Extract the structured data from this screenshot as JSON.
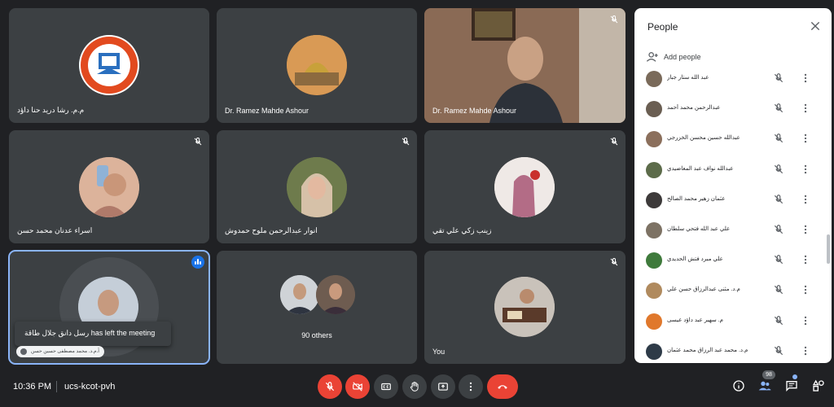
{
  "tiles": [
    {
      "name": "م.م. رشا دريد حنا داؤد",
      "muted": false
    },
    {
      "name": "Dr. Ramez Mahde Ashour",
      "muted": false
    },
    {
      "name": "Dr. Ramez Mahde Ashour",
      "muted": true
    },
    {
      "name": "اسراء عدنان محمد حسن",
      "muted": true
    },
    {
      "name": "انوار عبدالرحمن ملوح حمدوش",
      "muted": true
    },
    {
      "name": "زينب زكي علي تقي",
      "muted": true
    },
    {
      "name": "آ.م.د. محمد مصطفى حسين حسن",
      "muted": false
    },
    {
      "name": "90 others",
      "muted": false
    },
    {
      "name": "You",
      "muted": true
    }
  ],
  "toast": {
    "text": "رسل دانق جلال طاقة has left the meeting"
  },
  "hand_chip": {
    "text": "آ.م.د. محمد مصطفى حسين حسن"
  },
  "people": {
    "title": "People",
    "add_label": "Add people",
    "members": [
      {
        "name": "عبد الله ستار جبار"
      },
      {
        "name": "عبدالرحمن محمد أحمد"
      },
      {
        "name": "عبدالله حسين محسن الخزرجي"
      },
      {
        "name": "عبدالله نواف عبد المعاضيدي"
      },
      {
        "name": "عثمان زهير محمد الصالح"
      },
      {
        "name": "علي عبد الله فتحي سلطان"
      },
      {
        "name": "علي مبرد فتش الحديدي"
      },
      {
        "name": "م.د. مثنى عبدالرزاق حسن علي"
      },
      {
        "name": "م. سهير عبد داؤد عيسى"
      },
      {
        "name": "م.د. محمد عبد الرزاق محمد عثمان"
      }
    ]
  },
  "bottom": {
    "time": "10:36 PM",
    "meeting_code": "ucs-kcot-pvh",
    "participant_count": "98"
  },
  "colors": {
    "background": "#202124",
    "tile": "#3c4043",
    "end_call": "#ea4335",
    "accent": "#8ab4f8"
  }
}
